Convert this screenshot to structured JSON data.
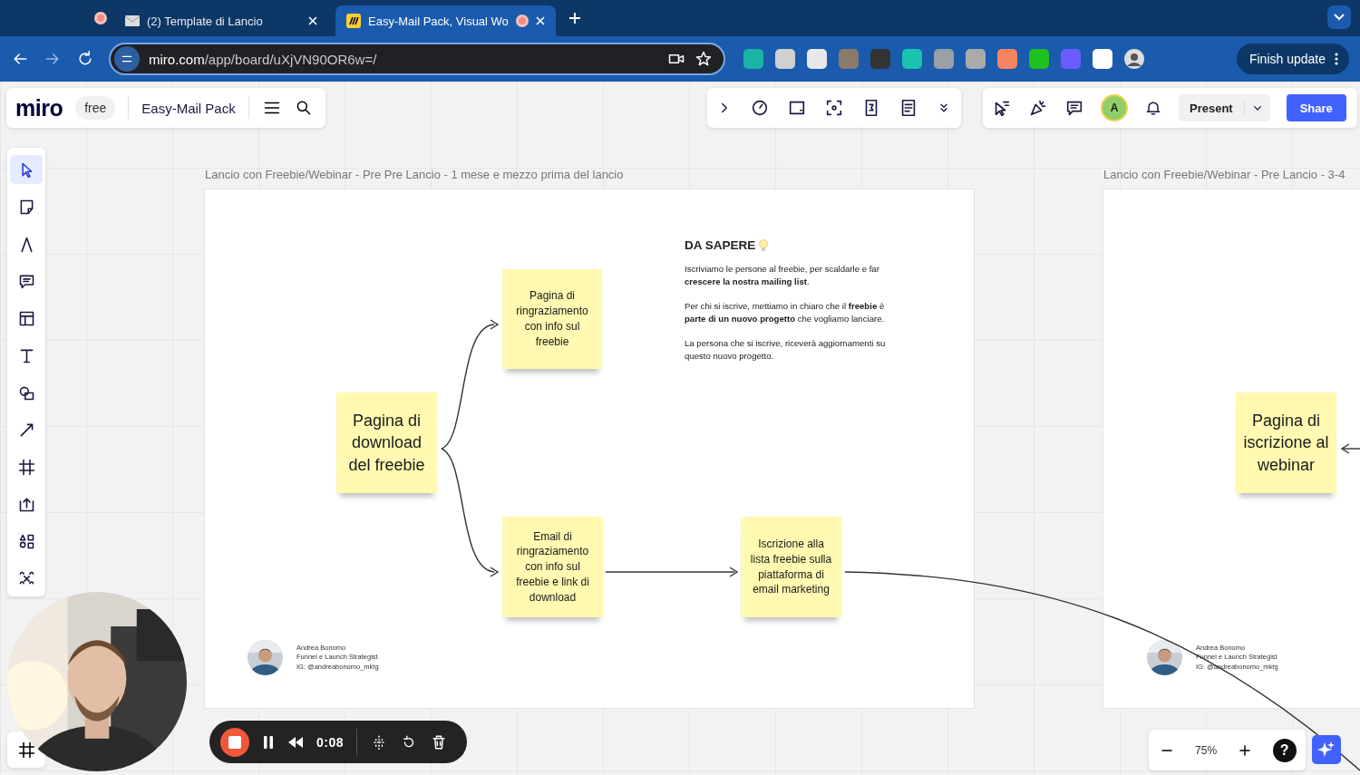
{
  "browser": {
    "tabs": [
      {
        "title": "(2) Template di Lancio",
        "selected": false
      },
      {
        "title": "Easy-Mail Pack, Visual Wo",
        "selected": true
      }
    ],
    "url_host": "miro.com",
    "url_path": "/app/board/uXjVN90OR6w=/",
    "update_button": "Finish update"
  },
  "board_header": {
    "logo": "miro",
    "plan": "free",
    "board_name": "Easy-Mail Pack"
  },
  "top_toolbar": {
    "avatar": "A",
    "present": "Present",
    "share": "Share"
  },
  "left_tools": [
    {
      "kind": "select",
      "selected": true
    },
    {
      "kind": "sticky",
      "selected": false
    },
    {
      "kind": "pen",
      "selected": false
    },
    {
      "kind": "comment",
      "selected": false
    },
    {
      "kind": "table",
      "selected": false
    },
    {
      "kind": "text",
      "selected": false
    },
    {
      "kind": "shapes",
      "selected": false
    },
    {
      "kind": "line",
      "selected": false
    },
    {
      "kind": "frame",
      "selected": false
    },
    {
      "kind": "upload",
      "selected": false
    },
    {
      "kind": "apps",
      "selected": false
    },
    {
      "kind": "mindmap",
      "selected": false
    }
  ],
  "frames": [
    {
      "title": "Lancio con Freebie/Webinar - Pre Pre Lancio - 1 mese e mezzo prima del lancio",
      "notes": [
        {
          "text": "Pagina di download del freebie"
        },
        {
          "text": "Pagina di ringraziamento con info sul freebie"
        },
        {
          "text": "Email di ringraziamento con info sul freebie e link di download"
        },
        {
          "text": "Iscrizione alla lista freebie sulla piattaforma di email marketing"
        }
      ],
      "info": {
        "heading": "DA SAPERE",
        "paragraphs": [
          "Iscriviamo le persone al freebie, per scaldarle e far **crescere la nostra mailing list**.",
          "Per chi si iscrive, mettiamo in chiaro che il **freebie** è **parte di un nuovo progetto** che vogliamo lanciare.",
          "La persona che si iscrive, riceverà aggiornamenti su questo nuovo progetto."
        ]
      },
      "author": {
        "name": "Andrea Bonomo",
        "role": "Funnel e Launch Strategist",
        "handle": "IG: @andreabonomo_mktg"
      }
    },
    {
      "title": "Lancio con Freebie/Webinar - Pre Lancio - 3-4",
      "notes": [
        {
          "text": "Pagina di iscrizione al webinar"
        }
      ],
      "author": {
        "name": "Andrea Bonomo",
        "role": "Funnel e Launch Strategist",
        "handle": "IG: @andreabonomo_mktg"
      }
    }
  ],
  "recorder": {
    "time": "0:08"
  },
  "zoom": {
    "level_text": "75%",
    "help": "?"
  }
}
